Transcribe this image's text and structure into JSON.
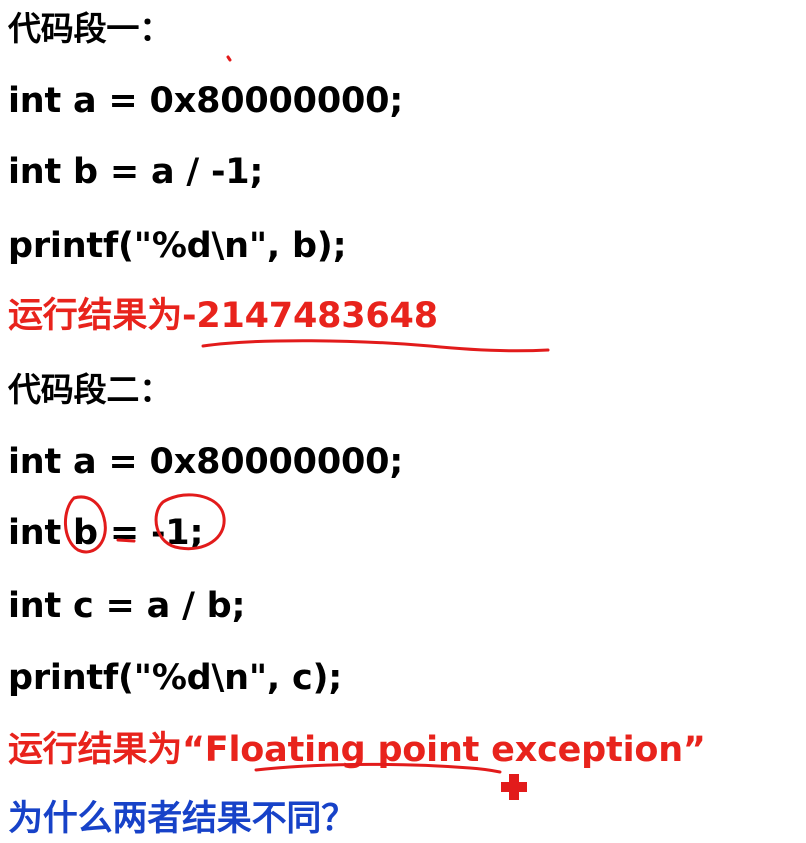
{
  "colors": {
    "text": "#000000",
    "result": "#e8231c",
    "question": "#1742c8",
    "annotation": "#e21b1b"
  },
  "snippet1": {
    "heading": "代码段一：",
    "lines": [
      "int a = 0x80000000;",
      "int b = a / -1;",
      "printf(\"%d\\n\", b);"
    ],
    "result": "运行结果为-2147483648"
  },
  "snippet2": {
    "heading": "代码段二：",
    "lines": [
      "int a = 0x80000000;",
      "int b = -1;",
      "int c = a / b;",
      "printf(\"%d\\n\", c);"
    ],
    "result": "运行结果为“Floating point exception”"
  },
  "question": "为什么两者结果不同？"
}
